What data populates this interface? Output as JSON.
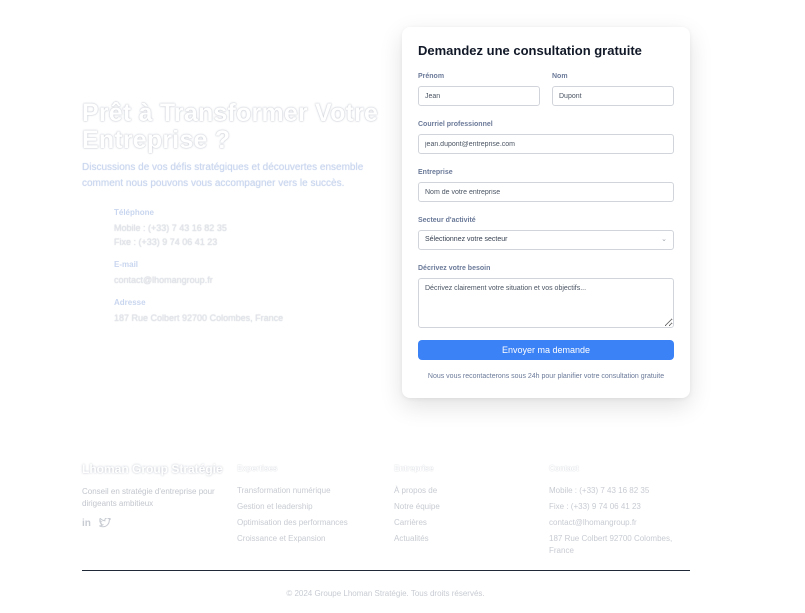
{
  "hero": {
    "title": "Prêt à Transformer Votre Entreprise ?",
    "subtitle": "Discussions de vos défis stratégiques et découvertes ensemble comment nous pouvons vous accompagner vers le succès.",
    "phone_label": "Téléphone",
    "phone_mobile": "Mobile : (+33) 7 43 16 82 35",
    "phone_fixe": "Fixe : (+33) 9 74 06 41 23",
    "email_label": "E-mail",
    "email_value": "contact@lhomangroup.fr",
    "address_label": "Adresse",
    "address_value": "187 Rue Colbert 92700 Colombes, France"
  },
  "form": {
    "title": "Demandez une consultation gratuite",
    "prenom_label": "Prénom",
    "prenom_placeholder": "Jean",
    "nom_label": "Nom",
    "nom_placeholder": "Dupont",
    "email_label": "Courriel professionnel",
    "email_placeholder": "jean.dupont@entreprise.com",
    "company_label": "Entreprise",
    "company_placeholder": "Nom de votre entreprise",
    "sector_label": "Secteur d'activité",
    "sector_value": "Sélectionnez votre secteur",
    "need_label": "Décrivez votre besoin",
    "need_placeholder": "Décrivez clairement votre situation et vos objectifs...",
    "submit_label": "Envoyer ma demande",
    "note": "Nous vous recontacterons sous 24h pour planifier votre consultation gratuite"
  },
  "footer": {
    "brand": "Lhoman Group Stratégie",
    "tagline": "Conseil en stratégie d'entreprise pour dirigeants ambitieux",
    "social": [
      "in",
      "tw"
    ],
    "columns": [
      {
        "heading": "Expertises",
        "items": [
          "Transformation numérique",
          "Gestion et leadership",
          "Optimisation des performances",
          "Croissance et Expansion"
        ]
      },
      {
        "heading": "Entreprise",
        "items": [
          "À propos de",
          "Notre équipe",
          "Carrières",
          "Actualités"
        ]
      },
      {
        "heading": "Contact",
        "items": [
          "Mobile : (+33) 7 43 16 82 35",
          "Fixe : (+33) 9 74 06 41 23",
          "contact@lhomangroup.fr",
          "187 Rue Colbert 92700 Colombes, France"
        ]
      }
    ],
    "copyright": "© 2024 Groupe Lhoman Stratégie. Tous droits réservés."
  },
  "colors": {
    "primary": "#3b82f6",
    "label": "#6b7a99",
    "faded_blue": "#c9d6ef"
  }
}
